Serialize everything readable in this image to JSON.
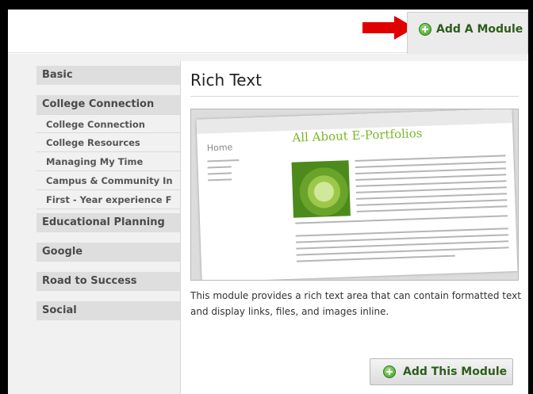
{
  "header": {
    "add_module_label": "Add A Module",
    "plus_icon": "plus-circle-icon",
    "arrow_icon": "red-arrow-icon",
    "arrow_color": "#e00000",
    "accent_green": "#3f9a2a"
  },
  "sidebar": {
    "categories": [
      {
        "label": "Basic"
      },
      {
        "label": "College Connection",
        "items": [
          "College Connection",
          "College Resources",
          "Managing My Time",
          "Campus & Community In",
          "First - Year experience F"
        ]
      },
      {
        "label": "Educational Planning"
      },
      {
        "label": "Google"
      },
      {
        "label": "Road to Success"
      },
      {
        "label": "Social"
      }
    ]
  },
  "panel": {
    "title": "Rich Text",
    "preview": {
      "home_label": "Home",
      "heading": "All About E-Portfolios"
    },
    "description": "This module provides a rich text area that can contain formatted text and display links, files, and images inline.",
    "add_button_label": "Add This Module"
  }
}
